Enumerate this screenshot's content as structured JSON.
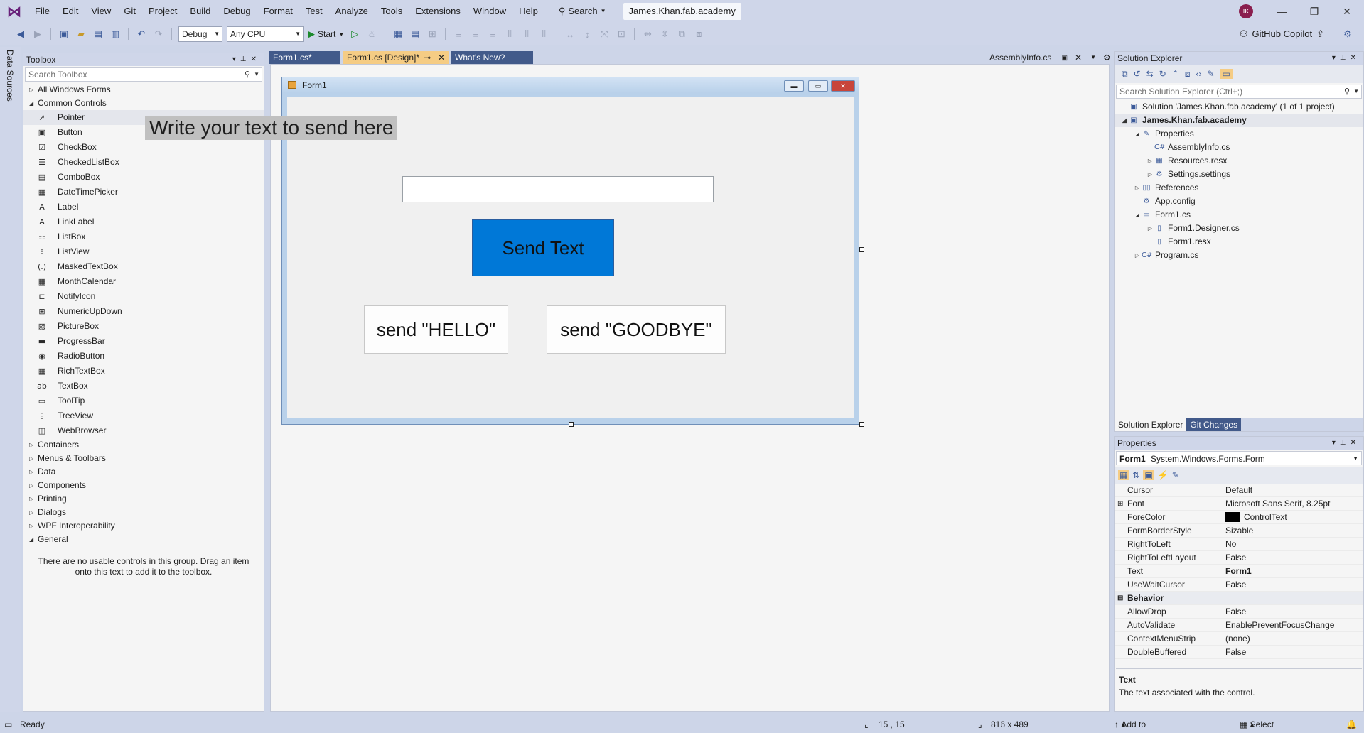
{
  "menu": {
    "items": [
      "File",
      "Edit",
      "View",
      "Git",
      "Project",
      "Build",
      "Debug",
      "Format",
      "Test",
      "Analyze",
      "Tools",
      "Extensions",
      "Window",
      "Help"
    ],
    "search_label": "Search",
    "project_name": "James.Khan.fab.academy",
    "avatar_initials": "IK"
  },
  "toolbar": {
    "config": "Debug",
    "platform": "Any CPU",
    "start_label": "Start",
    "copilot_label": "GitHub Copilot"
  },
  "side_strip": {
    "data_sources": "Data Sources"
  },
  "toolbox": {
    "title": "Toolbox",
    "search_placeholder": "Search Toolbox",
    "all_forms": "All Windows Forms",
    "common_controls": "Common Controls",
    "tools": [
      {
        "label": "Pointer",
        "icon": "pointer-icon"
      },
      {
        "label": "Button",
        "icon": "button-icon"
      },
      {
        "label": "CheckBox",
        "icon": "checkbox-icon"
      },
      {
        "label": "CheckedListBox",
        "icon": "checkedlistbox-icon"
      },
      {
        "label": "ComboBox",
        "icon": "combobox-icon"
      },
      {
        "label": "DateTimePicker",
        "icon": "datetimepicker-icon"
      },
      {
        "label": "Label",
        "icon": "label-icon"
      },
      {
        "label": "LinkLabel",
        "icon": "linklabel-icon"
      },
      {
        "label": "ListBox",
        "icon": "listbox-icon"
      },
      {
        "label": "ListView",
        "icon": "listview-icon"
      },
      {
        "label": "MaskedTextBox",
        "icon": "maskedtextbox-icon"
      },
      {
        "label": "MonthCalendar",
        "icon": "monthcalendar-icon"
      },
      {
        "label": "NotifyIcon",
        "icon": "notifyicon-icon"
      },
      {
        "label": "NumericUpDown",
        "icon": "numericupdown-icon"
      },
      {
        "label": "PictureBox",
        "icon": "picturebox-icon"
      },
      {
        "label": "ProgressBar",
        "icon": "progressbar-icon"
      },
      {
        "label": "RadioButton",
        "icon": "radiobutton-icon"
      },
      {
        "label": "RichTextBox",
        "icon": "richtextbox-icon"
      },
      {
        "label": "TextBox",
        "icon": "textbox-icon"
      },
      {
        "label": "ToolTip",
        "icon": "tooltip-icon"
      },
      {
        "label": "TreeView",
        "icon": "treeview-icon"
      },
      {
        "label": "WebBrowser",
        "icon": "webbrowser-icon"
      }
    ],
    "groups": [
      "Containers",
      "Menus & Toolbars",
      "Data",
      "Components",
      "Printing",
      "Dialogs",
      "WPF Interoperability"
    ],
    "general": "General",
    "empty_note": "There are no usable controls in this group. Drag an item onto this text to add it to the toolbox."
  },
  "tabs": {
    "form1_cs": "Form1.cs*",
    "form1_design": "Form1.cs [Design]*",
    "whats_new": "What's New?",
    "assemblyinfo": "AssemblyInfo.cs"
  },
  "form": {
    "title": "Form1",
    "label_text": "Write your text to send here",
    "textbox_value": "",
    "send_text_button": "Send Text",
    "hello_button": "send \"HELLO\"",
    "goodbye_button": "send \"GOODBYE\""
  },
  "solution_explorer": {
    "title": "Solution Explorer",
    "search_placeholder": "Search Solution Explorer (Ctrl+;)",
    "rows": [
      {
        "label": "Solution 'James.Khan.fab.academy' (1 of 1 project)"
      },
      {
        "label": "James.Khan.fab.academy"
      },
      {
        "label": "Properties"
      },
      {
        "label": "AssemblyInfo.cs"
      },
      {
        "label": "Resources.resx"
      },
      {
        "label": "Settings.settings"
      },
      {
        "label": "References"
      },
      {
        "label": "App.config"
      },
      {
        "label": "Form1.cs"
      },
      {
        "label": "Form1.Designer.cs"
      },
      {
        "label": "Form1.resx"
      },
      {
        "label": "Program.cs"
      }
    ],
    "tab_solution": "Solution Explorer",
    "tab_git": "Git Changes"
  },
  "properties": {
    "title": "Properties",
    "object_name": "Form1",
    "object_type": "System.Windows.Forms.Form",
    "rows": [
      {
        "key": "Cursor",
        "value": "Default"
      },
      {
        "key": "Font",
        "value": "Microsoft Sans Serif, 8.25pt"
      },
      {
        "key": "ForeColor",
        "value": "ControlText"
      },
      {
        "key": "FormBorderStyle",
        "value": "Sizable"
      },
      {
        "key": "RightToLeft",
        "value": "No"
      },
      {
        "key": "RightToLeftLayout",
        "value": "False"
      },
      {
        "key": "Text",
        "value": "Form1"
      },
      {
        "key": "UseWaitCursor",
        "value": "False"
      },
      {
        "key": "Behavior",
        "value": ""
      },
      {
        "key": "AllowDrop",
        "value": "False"
      },
      {
        "key": "AutoValidate",
        "value": "EnablePreventFocusChange"
      },
      {
        "key": "ContextMenuStrip",
        "value": "(none)"
      },
      {
        "key": "DoubleBuffered",
        "value": "False"
      }
    ],
    "desc_title": "Text",
    "desc_body": "The text associated with the control."
  },
  "status": {
    "ready": "Ready",
    "position": "15 , 15",
    "size": "816 x 489",
    "source_control": "Add to Source Control",
    "repository": "Select Repository"
  },
  "colors": {
    "accent": "#0078d7",
    "chrome": "#cfd6e9",
    "active_tab": "#f5cc84"
  }
}
